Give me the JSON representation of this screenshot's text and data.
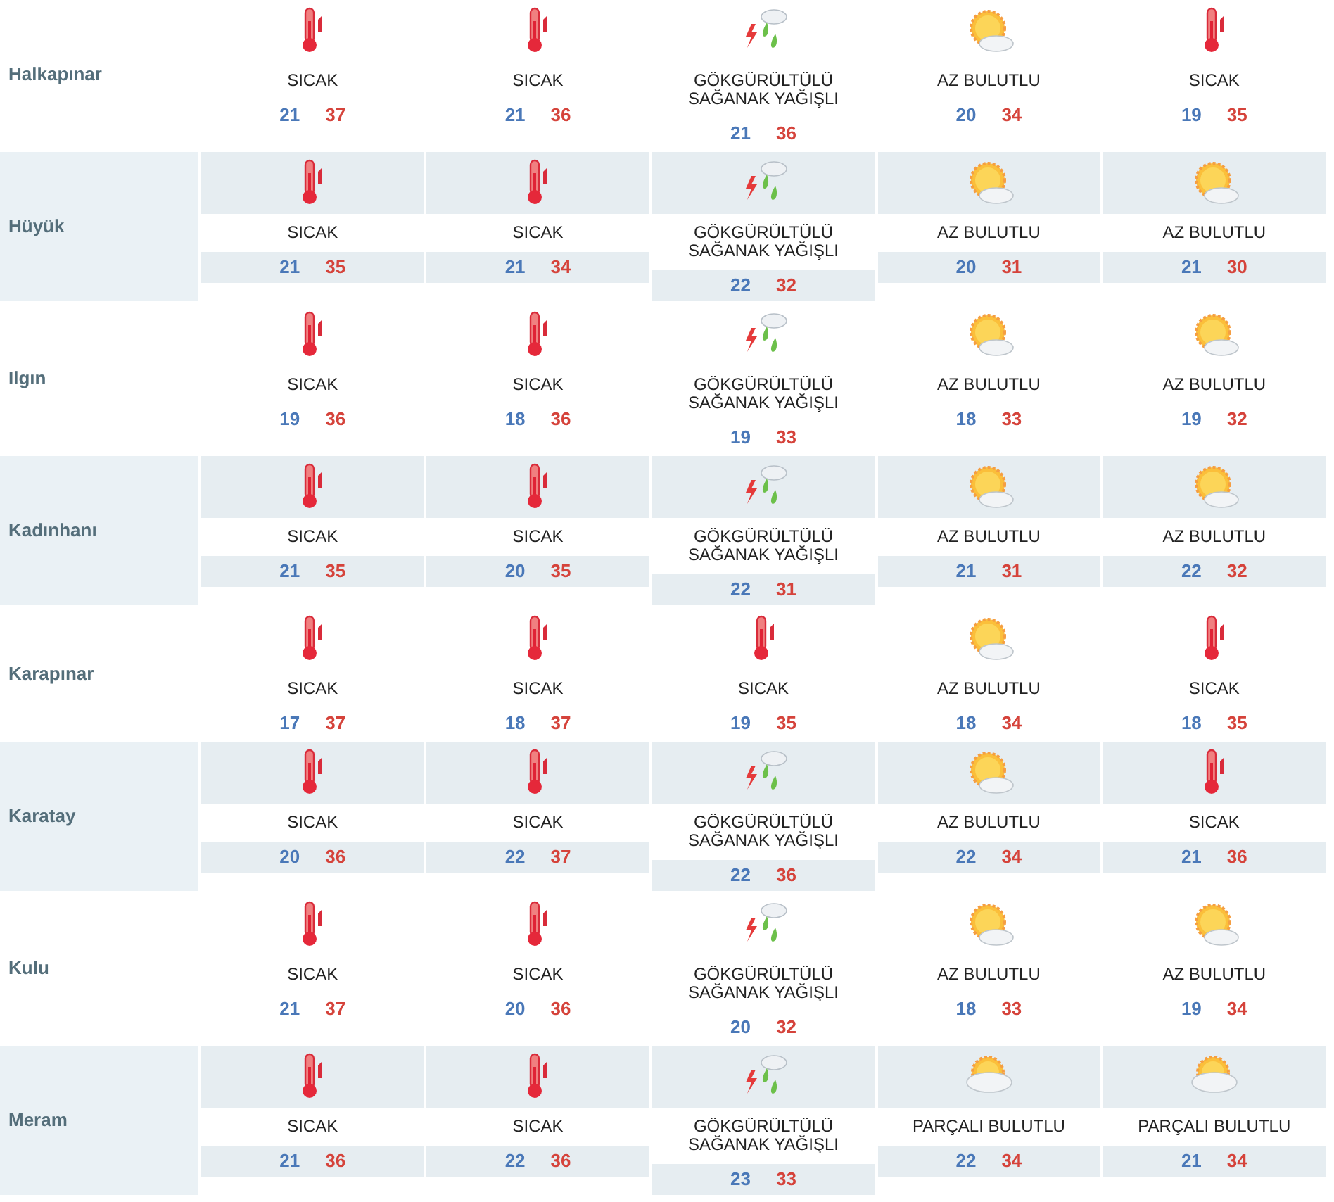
{
  "rows": [
    {
      "city": "Halkapınar",
      "shaded": false,
      "days": [
        {
          "kind": "hot",
          "condition": "SICAK",
          "low": "21",
          "high": "37"
        },
        {
          "kind": "hot",
          "condition": "SICAK",
          "low": "21",
          "high": "36"
        },
        {
          "kind": "storm",
          "condition": "GÖKGÜRÜLTÜLÜ SAĞANAK YAĞIŞLI",
          "low": "21",
          "high": "36"
        },
        {
          "kind": "few_clouds",
          "condition": "AZ BULUTLU",
          "low": "20",
          "high": "34"
        },
        {
          "kind": "hot",
          "condition": "SICAK",
          "low": "19",
          "high": "35"
        }
      ]
    },
    {
      "city": "Hüyük",
      "shaded": true,
      "days": [
        {
          "kind": "hot",
          "condition": "SICAK",
          "low": "21",
          "high": "35"
        },
        {
          "kind": "hot",
          "condition": "SICAK",
          "low": "21",
          "high": "34"
        },
        {
          "kind": "storm",
          "condition": "GÖKGÜRÜLTÜLÜ SAĞANAK YAĞIŞLI",
          "low": "22",
          "high": "32"
        },
        {
          "kind": "few_clouds",
          "condition": "AZ BULUTLU",
          "low": "20",
          "high": "31"
        },
        {
          "kind": "few_clouds",
          "condition": "AZ BULUTLU",
          "low": "21",
          "high": "30"
        }
      ]
    },
    {
      "city": "Ilgın",
      "shaded": false,
      "days": [
        {
          "kind": "hot",
          "condition": "SICAK",
          "low": "19",
          "high": "36"
        },
        {
          "kind": "hot",
          "condition": "SICAK",
          "low": "18",
          "high": "36"
        },
        {
          "kind": "storm",
          "condition": "GÖKGÜRÜLTÜLÜ SAĞANAK YAĞIŞLI",
          "low": "19",
          "high": "33"
        },
        {
          "kind": "few_clouds",
          "condition": "AZ BULUTLU",
          "low": "18",
          "high": "33"
        },
        {
          "kind": "few_clouds",
          "condition": "AZ BULUTLU",
          "low": "19",
          "high": "32"
        }
      ]
    },
    {
      "city": "Kadınhanı",
      "shaded": true,
      "days": [
        {
          "kind": "hot",
          "condition": "SICAK",
          "low": "21",
          "high": "35"
        },
        {
          "kind": "hot",
          "condition": "SICAK",
          "low": "20",
          "high": "35"
        },
        {
          "kind": "storm",
          "condition": "GÖKGÜRÜLTÜLÜ SAĞANAK YAĞIŞLI",
          "low": "22",
          "high": "31"
        },
        {
          "kind": "few_clouds",
          "condition": "AZ BULUTLU",
          "low": "21",
          "high": "31"
        },
        {
          "kind": "few_clouds",
          "condition": "AZ BULUTLU",
          "low": "22",
          "high": "32"
        }
      ]
    },
    {
      "city": "Karapınar",
      "shaded": false,
      "days": [
        {
          "kind": "hot",
          "condition": "SICAK",
          "low": "17",
          "high": "37"
        },
        {
          "kind": "hot",
          "condition": "SICAK",
          "low": "18",
          "high": "37"
        },
        {
          "kind": "hot",
          "condition": "SICAK",
          "low": "19",
          "high": "35"
        },
        {
          "kind": "few_clouds",
          "condition": "AZ BULUTLU",
          "low": "18",
          "high": "34"
        },
        {
          "kind": "hot",
          "condition": "SICAK",
          "low": "18",
          "high": "35"
        }
      ]
    },
    {
      "city": "Karatay",
      "shaded": true,
      "days": [
        {
          "kind": "hot",
          "condition": "SICAK",
          "low": "20",
          "high": "36"
        },
        {
          "kind": "hot",
          "condition": "SICAK",
          "low": "22",
          "high": "37"
        },
        {
          "kind": "storm",
          "condition": "GÖKGÜRÜLTÜLÜ SAĞANAK YAĞIŞLI",
          "low": "22",
          "high": "36"
        },
        {
          "kind": "few_clouds",
          "condition": "AZ BULUTLU",
          "low": "22",
          "high": "34"
        },
        {
          "kind": "hot",
          "condition": "SICAK",
          "low": "21",
          "high": "36"
        }
      ]
    },
    {
      "city": "Kulu",
      "shaded": false,
      "days": [
        {
          "kind": "hot",
          "condition": "SICAK",
          "low": "21",
          "high": "37"
        },
        {
          "kind": "hot",
          "condition": "SICAK",
          "low": "20",
          "high": "36"
        },
        {
          "kind": "storm",
          "condition": "GÖKGÜRÜLTÜLÜ SAĞANAK YAĞIŞLI",
          "low": "20",
          "high": "32"
        },
        {
          "kind": "few_clouds",
          "condition": "AZ BULUTLU",
          "low": "18",
          "high": "33"
        },
        {
          "kind": "few_clouds",
          "condition": "AZ BULUTLU",
          "low": "19",
          "high": "34"
        }
      ]
    },
    {
      "city": "Meram",
      "shaded": true,
      "days": [
        {
          "kind": "hot",
          "condition": "SICAK",
          "low": "21",
          "high": "36"
        },
        {
          "kind": "hot",
          "condition": "SICAK",
          "low": "22",
          "high": "36"
        },
        {
          "kind": "storm",
          "condition": "GÖKGÜRÜLTÜLÜ SAĞANAK YAĞIŞLI",
          "low": "23",
          "high": "33"
        },
        {
          "kind": "partly_cloudy",
          "condition": "PARÇALI BULUTLU",
          "low": "22",
          "high": "34"
        },
        {
          "kind": "partly_cloudy",
          "condition": "PARÇALI BULUTLU",
          "low": "21",
          "high": "34"
        }
      ]
    }
  ]
}
